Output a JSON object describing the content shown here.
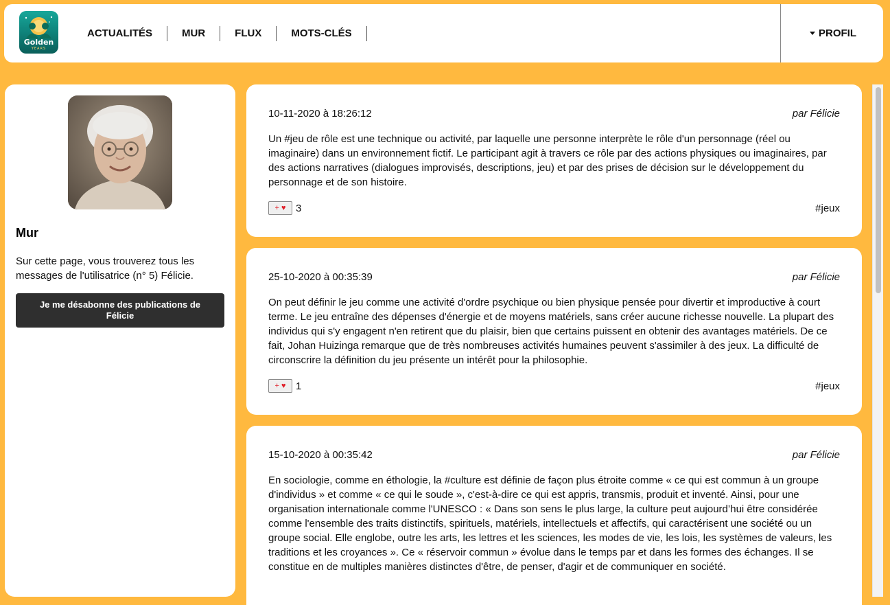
{
  "header": {
    "logo_text": "Golden",
    "logo_sub": "YEARS",
    "nav": [
      "ACTUALITÉS",
      "MUR",
      "FLUX",
      "MOTS-CLÉS"
    ],
    "profile_label": "PROFIL"
  },
  "sidebar": {
    "title": "Mur",
    "description": "Sur cette page, vous trouverez tous les messages de l'utilisatrice (n° 5) Félicie.",
    "unsubscribe_label": "Je me désabonne des publications de Félicie"
  },
  "posts": [
    {
      "date": "10-11-2020 à 18:26:12",
      "author": "par Félicie",
      "text": "Un #jeu de rôle est une technique ou activité, par laquelle une personne interprète le rôle d'un personnage (réel ou imaginaire) dans un environnement fictif. Le participant agit à travers ce rôle par des actions physiques ou imaginaires, par des actions narratives (dialogues improvisés, descriptions, jeu) et par des prises de décision sur le développement du personnage et de son histoire.",
      "like_label": "+",
      "likes": "3",
      "tag": "#jeux"
    },
    {
      "date": "25-10-2020 à 00:35:39",
      "author": "par Félicie",
      "text": "On peut définir le jeu comme une activité d'ordre psychique ou bien physique pensée pour divertir et improductive à court terme. Le jeu entraîne des dépenses d'énergie et de moyens matériels, sans créer aucune richesse nouvelle. La plupart des individus qui s'y engagent n'en retirent que du plaisir, bien que certains puissent en obtenir des avantages matériels. De ce fait, Johan Huizinga remarque que de très nombreuses activités humaines peuvent s'assimiler à des jeux. La difficulté de circonscrire la définition du jeu présente un intérêt pour la philosophie.",
      "like_label": "+",
      "likes": "1",
      "tag": "#jeux"
    },
    {
      "date": "15-10-2020 à 00:35:42",
      "author": "par Félicie",
      "text": "En sociologie, comme en éthologie, la #culture est définie de façon plus étroite comme « ce qui est commun à un groupe d'individus » et comme « ce qui le soude », c'est-à-dire ce qui est appris, transmis, produit et inventé. Ainsi, pour une organisation internationale comme l'UNESCO : « Dans son sens le plus large, la culture peut aujourd’hui être considérée comme l'ensemble des traits distinctifs, spirituels, matériels, intellectuels et affectifs, qui caractérisent une société ou un groupe social. Elle englobe, outre les arts, les lettres et les sciences, les modes de vie, les lois, les systèmes de valeurs, les traditions et les croyances ». Ce « réservoir commun » évolue dans le temps par et dans les formes des échanges. Il se constitue en de multiples manières distinctes d'être, de penser, d'agir et de communiquer en société."
    }
  ]
}
